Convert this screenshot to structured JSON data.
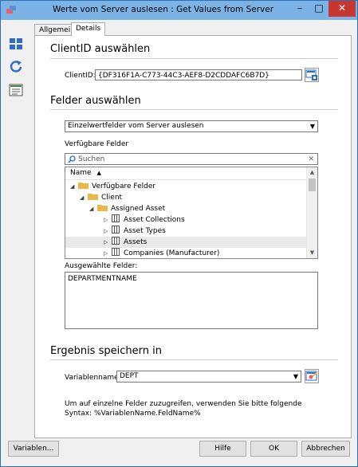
{
  "window": {
    "title": "Werte vom Server auslesen : Get Values from Server",
    "min": "–",
    "max": "□",
    "close": "✕"
  },
  "tabs": [
    "Allgemein",
    "Details"
  ],
  "client": {
    "section_title": "ClientID auswählen",
    "label": "ClientID:",
    "value": "{DF316F1A-C773-44C3-AEF8-D2CDDAFC6B7D}"
  },
  "fields": {
    "section_title": "Felder auswählen",
    "mode_select": "Einzelwertfelder vom Server auslesen",
    "available_label": "Verfügbare Felder",
    "search_placeholder": "Suchen",
    "search_clear": "✕",
    "column_header": "Name",
    "sort_glyph": "▲",
    "tree": [
      {
        "label": "Verfügbare Felder",
        "expander": "◢",
        "icon": "folder"
      },
      {
        "label": "Client",
        "expander": "◢",
        "icon": "folder"
      },
      {
        "label": "Assigned Asset",
        "expander": "◢",
        "icon": "folder"
      },
      {
        "label": "Asset Collections",
        "expander": "▷",
        "icon": "grid"
      },
      {
        "label": "Asset Types",
        "expander": "▷",
        "icon": "grid"
      },
      {
        "label": "Assets",
        "expander": "▷",
        "icon": "grid",
        "selected": true
      },
      {
        "label": "Companies (Manufacturer)",
        "expander": "▷",
        "icon": "grid"
      }
    ],
    "selected_label": "Ausgewählte Felder:",
    "selected_value": "DEPARTMENTNAME"
  },
  "result": {
    "section_title": "Ergebnis speichern in",
    "var_label": "Variablenname:",
    "var_value": "DEPT",
    "hint": "Um auf einzelne Felder zuzugreifen, verwenden Sie bitte folgende Syntax: %VariablenName.FeldName%"
  },
  "buttons": {
    "variables": "Variablen...",
    "help": "Hilfe",
    "ok": "OK",
    "cancel": "Abbrechen"
  },
  "colors": {
    "titlebar": "#7bb3e6",
    "close": "#c7372f",
    "folder": "#e8b84a",
    "accent": "#1e73be"
  }
}
